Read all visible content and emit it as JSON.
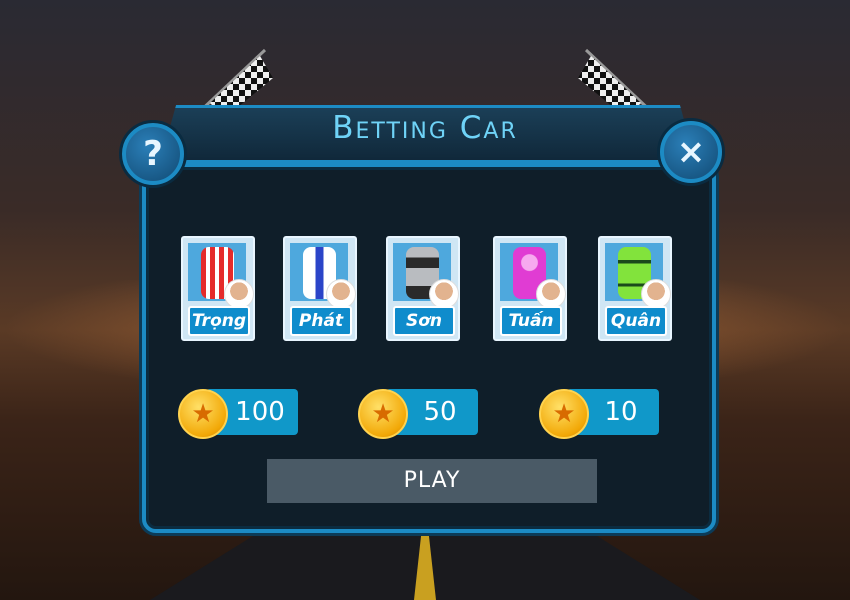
{
  "title": "Betting Car",
  "buttons": {
    "help_label": "?",
    "close_label": "×",
    "play_label": "PLAY"
  },
  "cars": [
    {
      "name": "Trọng",
      "color": "#e52b2b",
      "stripe": "#ffffff"
    },
    {
      "name": "Phát",
      "color": "#ffffff",
      "stripe": "#2b44c8"
    },
    {
      "name": "Sơn",
      "color": "#b9bcc0",
      "stripe": "#2a2a2a"
    },
    {
      "name": "Tuấn",
      "color": "#e03cd3",
      "stripe": "#a51ea0"
    },
    {
      "name": "Quân",
      "color": "#82e33c",
      "stripe": "#1b4a1b"
    }
  ],
  "bets": [
    {
      "amount": "100",
      "icon": "star-coin-icon"
    },
    {
      "amount": "50",
      "icon": "star-coin-icon"
    },
    {
      "amount": "10",
      "icon": "star-coin-icon"
    }
  ],
  "colors": {
    "accent": "#1c8bc4",
    "panel": "#0f1e29",
    "bet_bar": "#1098c9",
    "title": "#6fd3f7"
  }
}
